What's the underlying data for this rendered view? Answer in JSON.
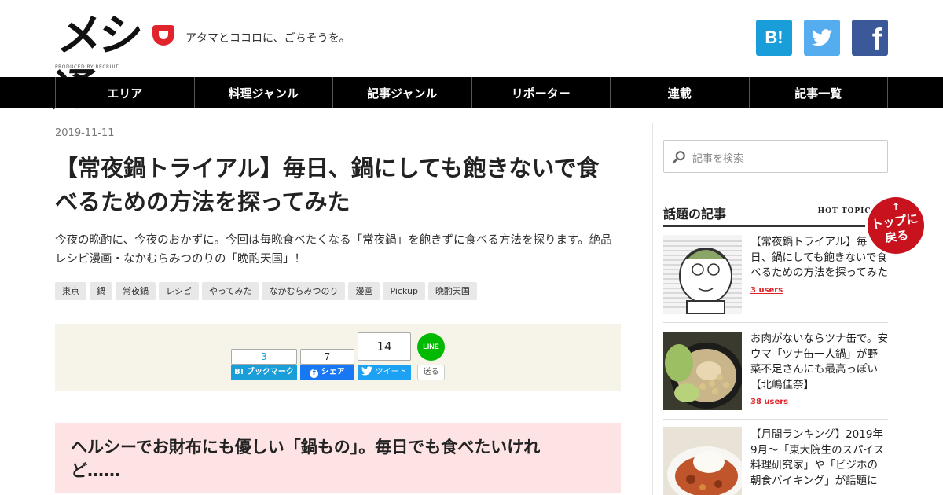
{
  "site": {
    "logo_text": "メシ通",
    "logo_produced": "PRODUCED BY RECRUIT",
    "tagline": "アタマとココロに、ごちそうを。",
    "social": [
      {
        "name": "hatena",
        "label": "B!",
        "color": "#1a9ed9"
      },
      {
        "name": "twitter",
        "icon": "twitter-bird-icon",
        "color": "#55acee"
      },
      {
        "name": "facebook",
        "label": "f",
        "color": "#3b5998"
      }
    ]
  },
  "nav": [
    "エリア",
    "料理ジャンル",
    "記事ジャンル",
    "リポーター",
    "連載",
    "記事一覧"
  ],
  "article": {
    "date": "2019-11-11",
    "title": "【常夜鍋トライアル】毎日、鍋にしても飽きないで食べるための方法を探ってみた",
    "lead": "今夜の晩酌に、今夜のおかずに。今回は毎晩食べたくなる「常夜鍋」を飽きずに食べる方法を探ります。絶品レシピ漫画・なかむらみつのりの「晩酌天国」！",
    "tags": [
      "東京",
      "鍋",
      "常夜鍋",
      "レシピ",
      "やってみた",
      "なかむらみつのり",
      "漫画",
      "Pickup",
      "晩酌天国"
    ],
    "share": {
      "hatena_count": "3",
      "hatena_label": "B! ブックマーク",
      "facebook_count": "7",
      "facebook_label": "シェア",
      "twitter_count": "14",
      "twitter_label": "ツイート",
      "line_logo": "LINE",
      "line_label": "送る"
    },
    "callout": "ヘルシーでお財布にも優しい「鍋もの」。毎日でも食べたいけれど……"
  },
  "sidebar": {
    "search_placeholder": "記事を検索",
    "topics_title": "話題の記事",
    "topics_sub": "HOT TOPICS",
    "articles": [
      {
        "title": "【常夜鍋トライアル】毎日、鍋にしても飽きないで食べるための方法を探ってみた",
        "users": "3 users"
      },
      {
        "title": "お肉がないならツナ缶で。安ウマ「ツナ缶一人鍋」が野菜不足さんにも最高っぽい【北嶋佳奈】",
        "users": "38 users"
      },
      {
        "title": "【月間ランキング】2019年9月～「東大院生のスパイス料理研究家」や「ビジホの朝食バイキング」が話題に",
        "users": ""
      }
    ],
    "totop_arrow": "↑",
    "totop_label": "トップに戻る"
  },
  "colors": {
    "accent_red": "#e1232c",
    "nav_bg": "#000000",
    "share_bg": "#f6f3e9",
    "callout_bg": "#fde3e3"
  }
}
